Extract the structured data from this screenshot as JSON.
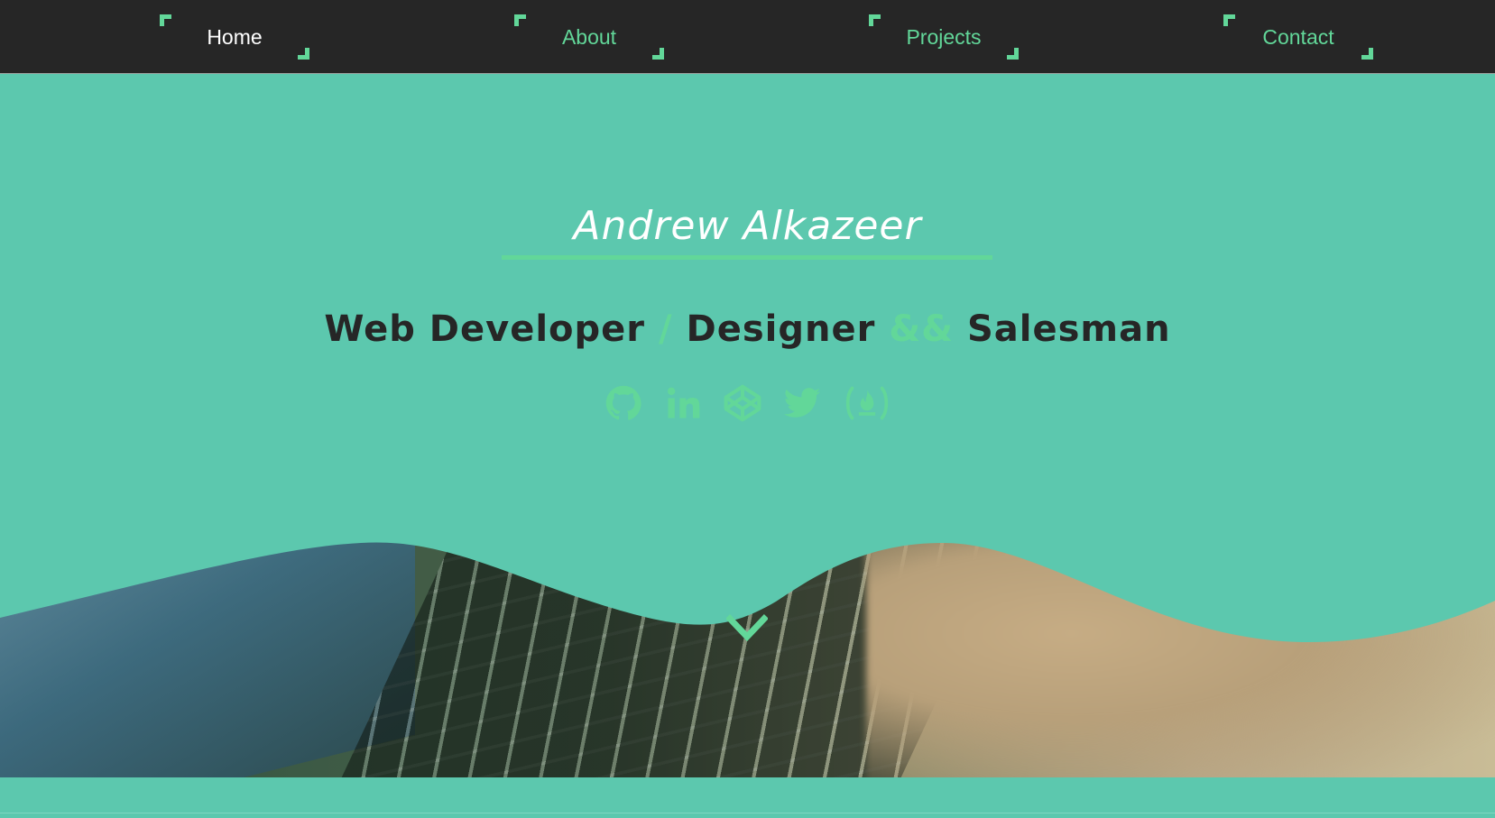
{
  "nav": {
    "items": [
      {
        "label": "Home",
        "active": true
      },
      {
        "label": "About",
        "active": false
      },
      {
        "label": "Projects",
        "active": false
      },
      {
        "label": "Contact",
        "active": false
      }
    ]
  },
  "hero": {
    "name": "Andrew Alkazeer",
    "tagline": {
      "part1": "Web Developer",
      "sep1": " / ",
      "part2": "Designer",
      "sep2": " && ",
      "part3": "Salesman"
    },
    "social": [
      "github-icon",
      "linkedin-icon",
      "codepen-icon",
      "twitter-icon",
      "freecodecamp-icon"
    ]
  },
  "colors": {
    "nav_bg": "#262626",
    "accent": "#62d799",
    "hero_bg": "#5cc8ae",
    "text_dark": "#262626"
  }
}
